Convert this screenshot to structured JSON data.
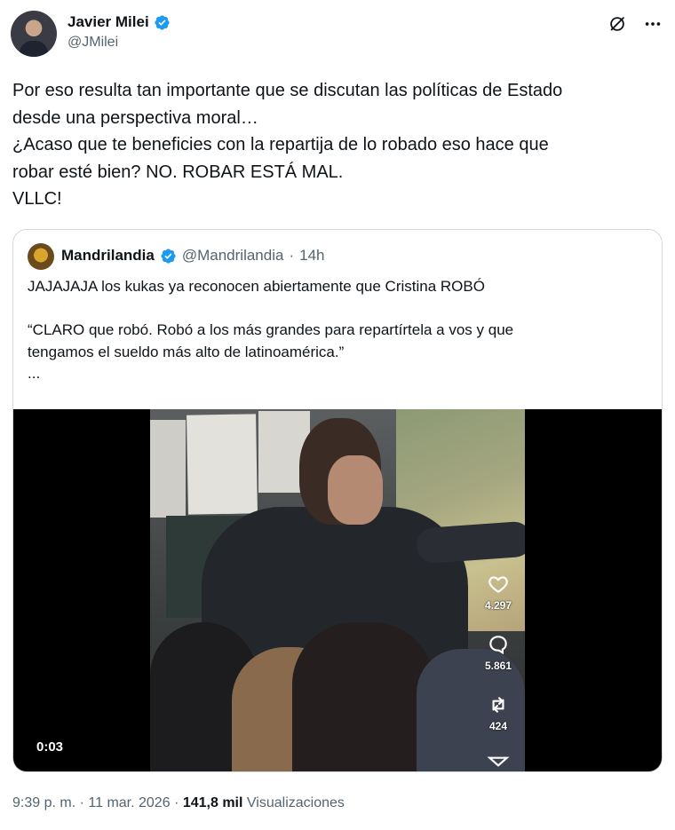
{
  "author": {
    "name": "Javier Milei",
    "handle": "@JMilei"
  },
  "icons": {
    "verified": "verified-badge-icon",
    "grok": "grok-icon",
    "more": "more-options-icon"
  },
  "tweet": {
    "lines": [
      "Por eso resulta tan importante que se discutan las políticas de Estado",
      "desde una perspectiva moral…",
      "¿Acaso que te beneficies con la repartija de lo robado eso hace que",
      "robar esté bien? NO. ROBAR ESTÁ MAL.",
      "VLLC!"
    ]
  },
  "quote": {
    "name": "Mandrilandia",
    "handle": "@Mandrilandia",
    "sep": "·",
    "time": "14h",
    "lines": [
      "JAJAJAJA los kukas ya reconocen abiertamente que Cristina ROBÓ",
      "",
      "“CLARO que robó. Robó a los más grandes para repartírtela a vos y que",
      "tengamos el sueldo más alto de latinoamérica.”",
      "..."
    ],
    "video": {
      "duration": "0:03",
      "likes": "4.297",
      "comments": "5.861",
      "reposts": "424"
    }
  },
  "meta": {
    "time": "9:39 p. m.",
    "sep1": "·",
    "date": "11 mar. 2026",
    "sep2": "·",
    "views_count": "141,8 mil",
    "views_label": "Visualizaciones"
  },
  "colors": {
    "text": "#0f1419",
    "muted": "#536471",
    "verified": "#1d9bf0",
    "border": "#cfd9de"
  }
}
